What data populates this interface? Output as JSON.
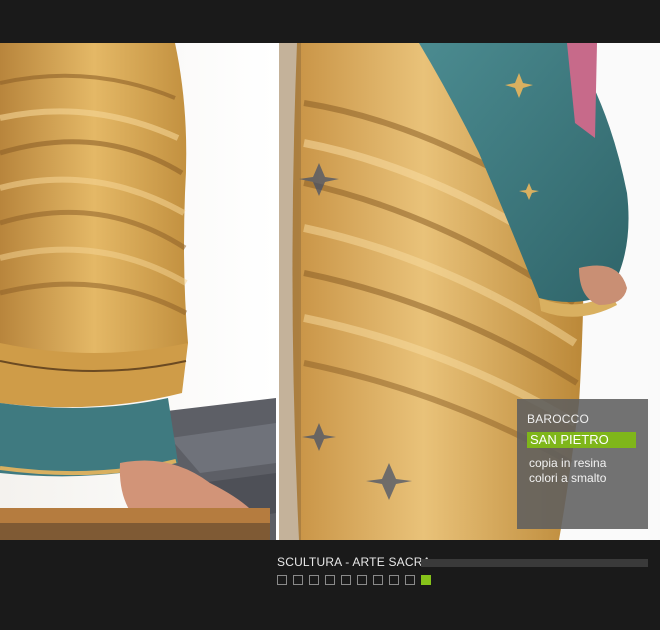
{
  "gallery": {
    "caption": "SCULTURA - ARTE SACRA",
    "page_count": 10,
    "active_index": 9
  },
  "info": {
    "style": "BAROCCO",
    "title": "SAN PIETRO",
    "line1": "copia in resina",
    "line2": "colori a smalto"
  },
  "colors": {
    "accent": "#86c21a",
    "background": "#1a1a1a",
    "robe_gold": "#d9a955",
    "robe_teal": "#3f7a80"
  }
}
